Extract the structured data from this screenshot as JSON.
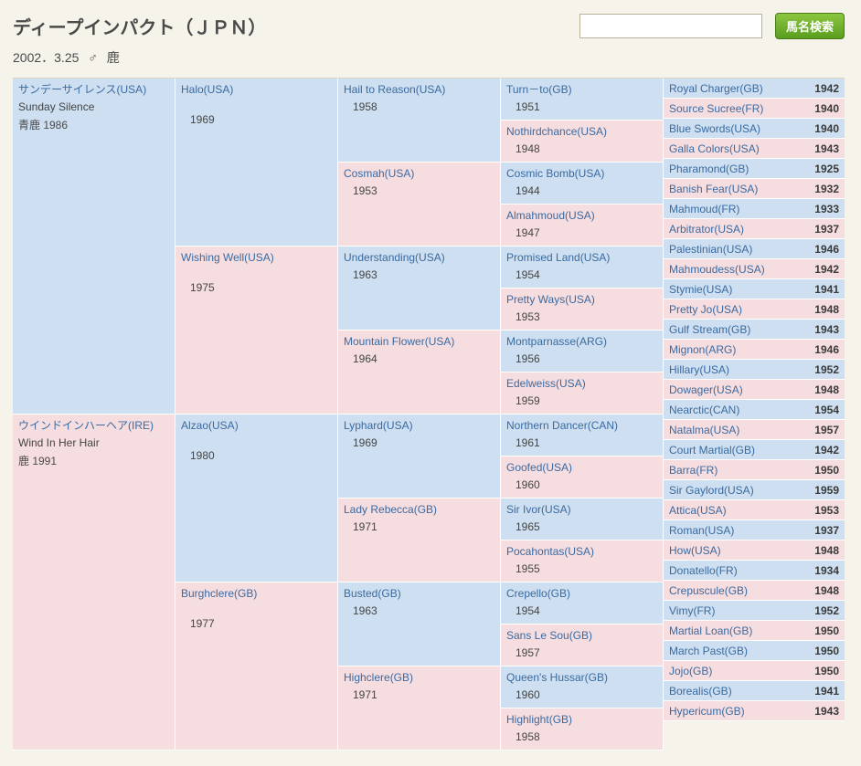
{
  "header": {
    "title": "ディープインパクト（ＪＰＮ）",
    "search_btn": "馬名検索",
    "search_placeholder": ""
  },
  "meta": {
    "birth": "2002．3.25",
    "sex": "♂",
    "color": "鹿"
  },
  "g1": [
    {
      "name": "サンデーサイレンス(USA)",
      "en": "Sunday Silence",
      "info": "青鹿 1986",
      "sex": "m"
    },
    {
      "name": "ウインドインハーヘア(IRE)",
      "en": "Wind In Her Hair",
      "info": "鹿 1991",
      "sex": "f"
    }
  ],
  "g2": [
    {
      "name": "Halo(USA)",
      "year": "1969",
      "sex": "m"
    },
    {
      "name": "Wishing Well(USA)",
      "year": "1975",
      "sex": "f"
    },
    {
      "name": "Alzao(USA)",
      "year": "1980",
      "sex": "m"
    },
    {
      "name": "Burghclere(GB)",
      "year": "1977",
      "sex": "f"
    }
  ],
  "g3": [
    {
      "name": "Hail to Reason(USA)",
      "year": "1958",
      "sex": "m"
    },
    {
      "name": "Cosmah(USA)",
      "year": "1953",
      "sex": "f"
    },
    {
      "name": "Understanding(USA)",
      "year": "1963",
      "sex": "m"
    },
    {
      "name": "Mountain Flower(USA)",
      "year": "1964",
      "sex": "f"
    },
    {
      "name": "Lyphard(USA)",
      "year": "1969",
      "sex": "m"
    },
    {
      "name": "Lady Rebecca(GB)",
      "year": "1971",
      "sex": "f"
    },
    {
      "name": "Busted(GB)",
      "year": "1963",
      "sex": "m"
    },
    {
      "name": "Highclere(GB)",
      "year": "1971",
      "sex": "f"
    }
  ],
  "g4": [
    {
      "name": "Turn－to(GB)",
      "year": "1951",
      "sex": "m"
    },
    {
      "name": "Nothirdchance(USA)",
      "year": "1948",
      "sex": "f"
    },
    {
      "name": "Cosmic Bomb(USA)",
      "year": "1944",
      "sex": "m"
    },
    {
      "name": "Almahmoud(USA)",
      "year": "1947",
      "sex": "f"
    },
    {
      "name": "Promised Land(USA)",
      "year": "1954",
      "sex": "m"
    },
    {
      "name": "Pretty Ways(USA)",
      "year": "1953",
      "sex": "f"
    },
    {
      "name": "Montparnasse(ARG)",
      "year": "1956",
      "sex": "m"
    },
    {
      "name": "Edelweiss(USA)",
      "year": "1959",
      "sex": "f"
    },
    {
      "name": "Northern Dancer(CAN)",
      "year": "1961",
      "sex": "m"
    },
    {
      "name": "Goofed(USA)",
      "year": "1960",
      "sex": "f"
    },
    {
      "name": "Sir Ivor(USA)",
      "year": "1965",
      "sex": "m"
    },
    {
      "name": "Pocahontas(USA)",
      "year": "1955",
      "sex": "f"
    },
    {
      "name": "Crepello(GB)",
      "year": "1954",
      "sex": "m"
    },
    {
      "name": "Sans Le Sou(GB)",
      "year": "1957",
      "sex": "f"
    },
    {
      "name": "Queen's Hussar(GB)",
      "year": "1960",
      "sex": "m"
    },
    {
      "name": "Highlight(GB)",
      "year": "1958",
      "sex": "f"
    }
  ],
  "g5": [
    {
      "name": "Royal Charger(GB)",
      "year": "1942",
      "sex": "m"
    },
    {
      "name": "Source Sucree(FR)",
      "year": "1940",
      "sex": "f"
    },
    {
      "name": "Blue Swords(USA)",
      "year": "1940",
      "sex": "m"
    },
    {
      "name": "Galla Colors(USA)",
      "year": "1943",
      "sex": "f"
    },
    {
      "name": "Pharamond(GB)",
      "year": "1925",
      "sex": "m"
    },
    {
      "name": "Banish Fear(USA)",
      "year": "1932",
      "sex": "f"
    },
    {
      "name": "Mahmoud(FR)",
      "year": "1933",
      "sex": "m"
    },
    {
      "name": "Arbitrator(USA)",
      "year": "1937",
      "sex": "f"
    },
    {
      "name": "Palestinian(USA)",
      "year": "1946",
      "sex": "m"
    },
    {
      "name": "Mahmoudess(USA)",
      "year": "1942",
      "sex": "f"
    },
    {
      "name": "Stymie(USA)",
      "year": "1941",
      "sex": "m"
    },
    {
      "name": "Pretty Jo(USA)",
      "year": "1948",
      "sex": "f"
    },
    {
      "name": "Gulf Stream(GB)",
      "year": "1943",
      "sex": "m"
    },
    {
      "name": "Mignon(ARG)",
      "year": "1946",
      "sex": "f"
    },
    {
      "name": "Hillary(USA)",
      "year": "1952",
      "sex": "m"
    },
    {
      "name": "Dowager(USA)",
      "year": "1948",
      "sex": "f"
    },
    {
      "name": "Nearctic(CAN)",
      "year": "1954",
      "sex": "m"
    },
    {
      "name": "Natalma(USA)",
      "year": "1957",
      "sex": "f"
    },
    {
      "name": "Court Martial(GB)",
      "year": "1942",
      "sex": "m"
    },
    {
      "name": "Barra(FR)",
      "year": "1950",
      "sex": "f"
    },
    {
      "name": "Sir Gaylord(USA)",
      "year": "1959",
      "sex": "m"
    },
    {
      "name": "Attica(USA)",
      "year": "1953",
      "sex": "f"
    },
    {
      "name": "Roman(USA)",
      "year": "1937",
      "sex": "m"
    },
    {
      "name": "How(USA)",
      "year": "1948",
      "sex": "f"
    },
    {
      "name": "Donatello(FR)",
      "year": "1934",
      "sex": "m"
    },
    {
      "name": "Crepuscule(GB)",
      "year": "1948",
      "sex": "f"
    },
    {
      "name": "Vimy(FR)",
      "year": "1952",
      "sex": "m"
    },
    {
      "name": "Martial Loan(GB)",
      "year": "1950",
      "sex": "f"
    },
    {
      "name": "March Past(GB)",
      "year": "1950",
      "sex": "m"
    },
    {
      "name": "Jojo(GB)",
      "year": "1950",
      "sex": "f"
    },
    {
      "name": "Borealis(GB)",
      "year": "1941",
      "sex": "m"
    },
    {
      "name": "Hypericum(GB)",
      "year": "1943",
      "sex": "f"
    }
  ]
}
